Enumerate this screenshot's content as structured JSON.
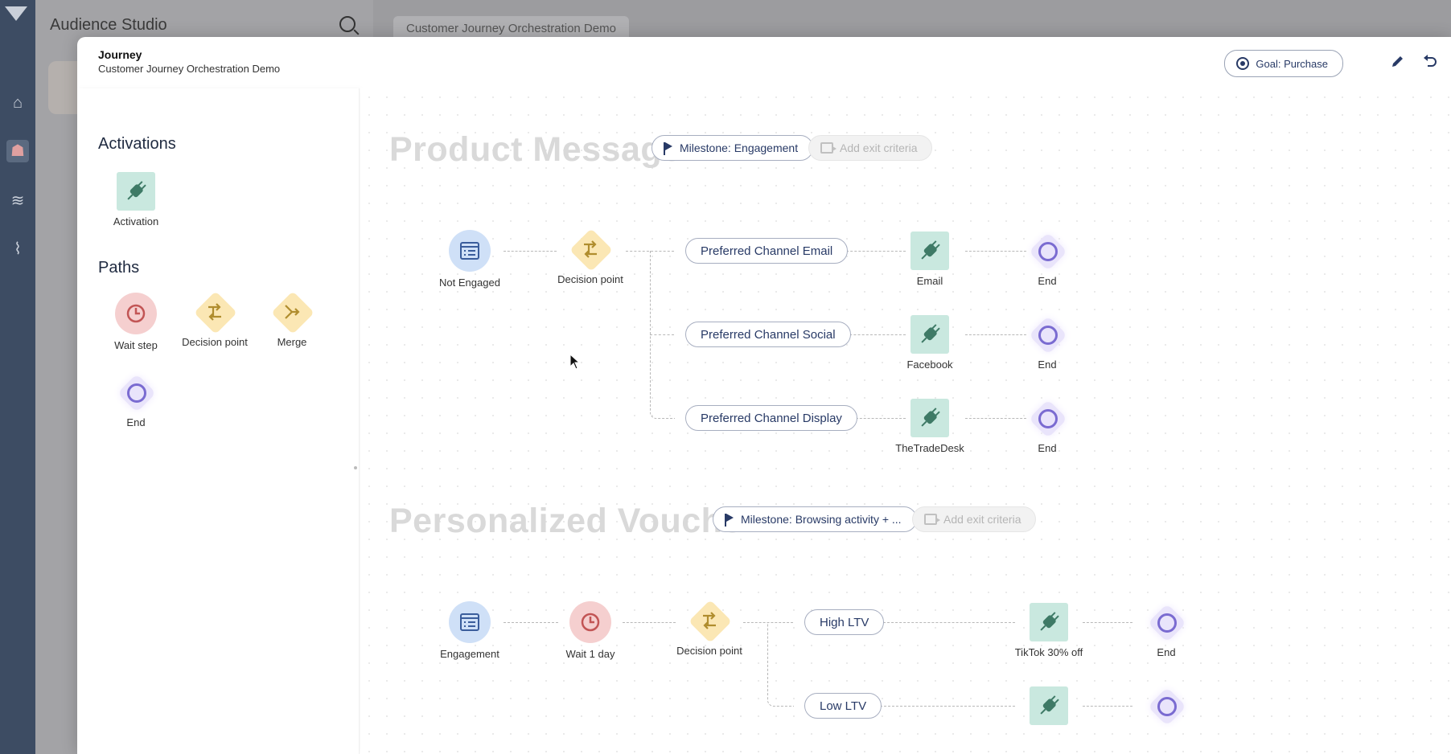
{
  "background": {
    "app_title": "Audience Studio",
    "tab_label": "Customer Journey Orchestration Demo"
  },
  "modal": {
    "kicker": "Journey",
    "subtitle": "Customer Journey Orchestration Demo",
    "goal_label": "Goal: Purchase"
  },
  "palette": {
    "activations_heading": "Activations",
    "activation_label": "Activation",
    "paths_heading": "Paths",
    "wait_label": "Wait step",
    "decision_label": "Decision point",
    "merge_label": "Merge",
    "end_label": "End"
  },
  "sections": {
    "product": {
      "title": "Product Message",
      "milestone": "Milestone: Engagement",
      "exit": "Add exit criteria",
      "nodes": {
        "start": "Not Engaged",
        "decision": "Decision point",
        "branch_email": "Preferred Channel Email",
        "branch_social": "Preferred Channel Social",
        "branch_display": "Preferred Channel Display",
        "act_email": "Email",
        "act_facebook": "Facebook",
        "act_tradedesk": "TheTradeDesk",
        "end": "End"
      }
    },
    "voucher": {
      "title": "Personalized Voucher",
      "milestone": "Milestone: Browsing activity + ...",
      "exit": "Add exit criteria",
      "nodes": {
        "start": "Engagement",
        "wait": "Wait 1 day",
        "decision": "Decision point",
        "branch_high": "High LTV",
        "branch_low": "Low LTV",
        "act_tiktok": "TikTok 30% off",
        "end": "End"
      }
    }
  },
  "colors": {
    "accent": "#283a66",
    "end": "#7a6bd1",
    "activation": "#c9e8df",
    "decision": "#fbe7b4",
    "wait": "#f5cfcf",
    "entry": "#cfe0f7"
  }
}
